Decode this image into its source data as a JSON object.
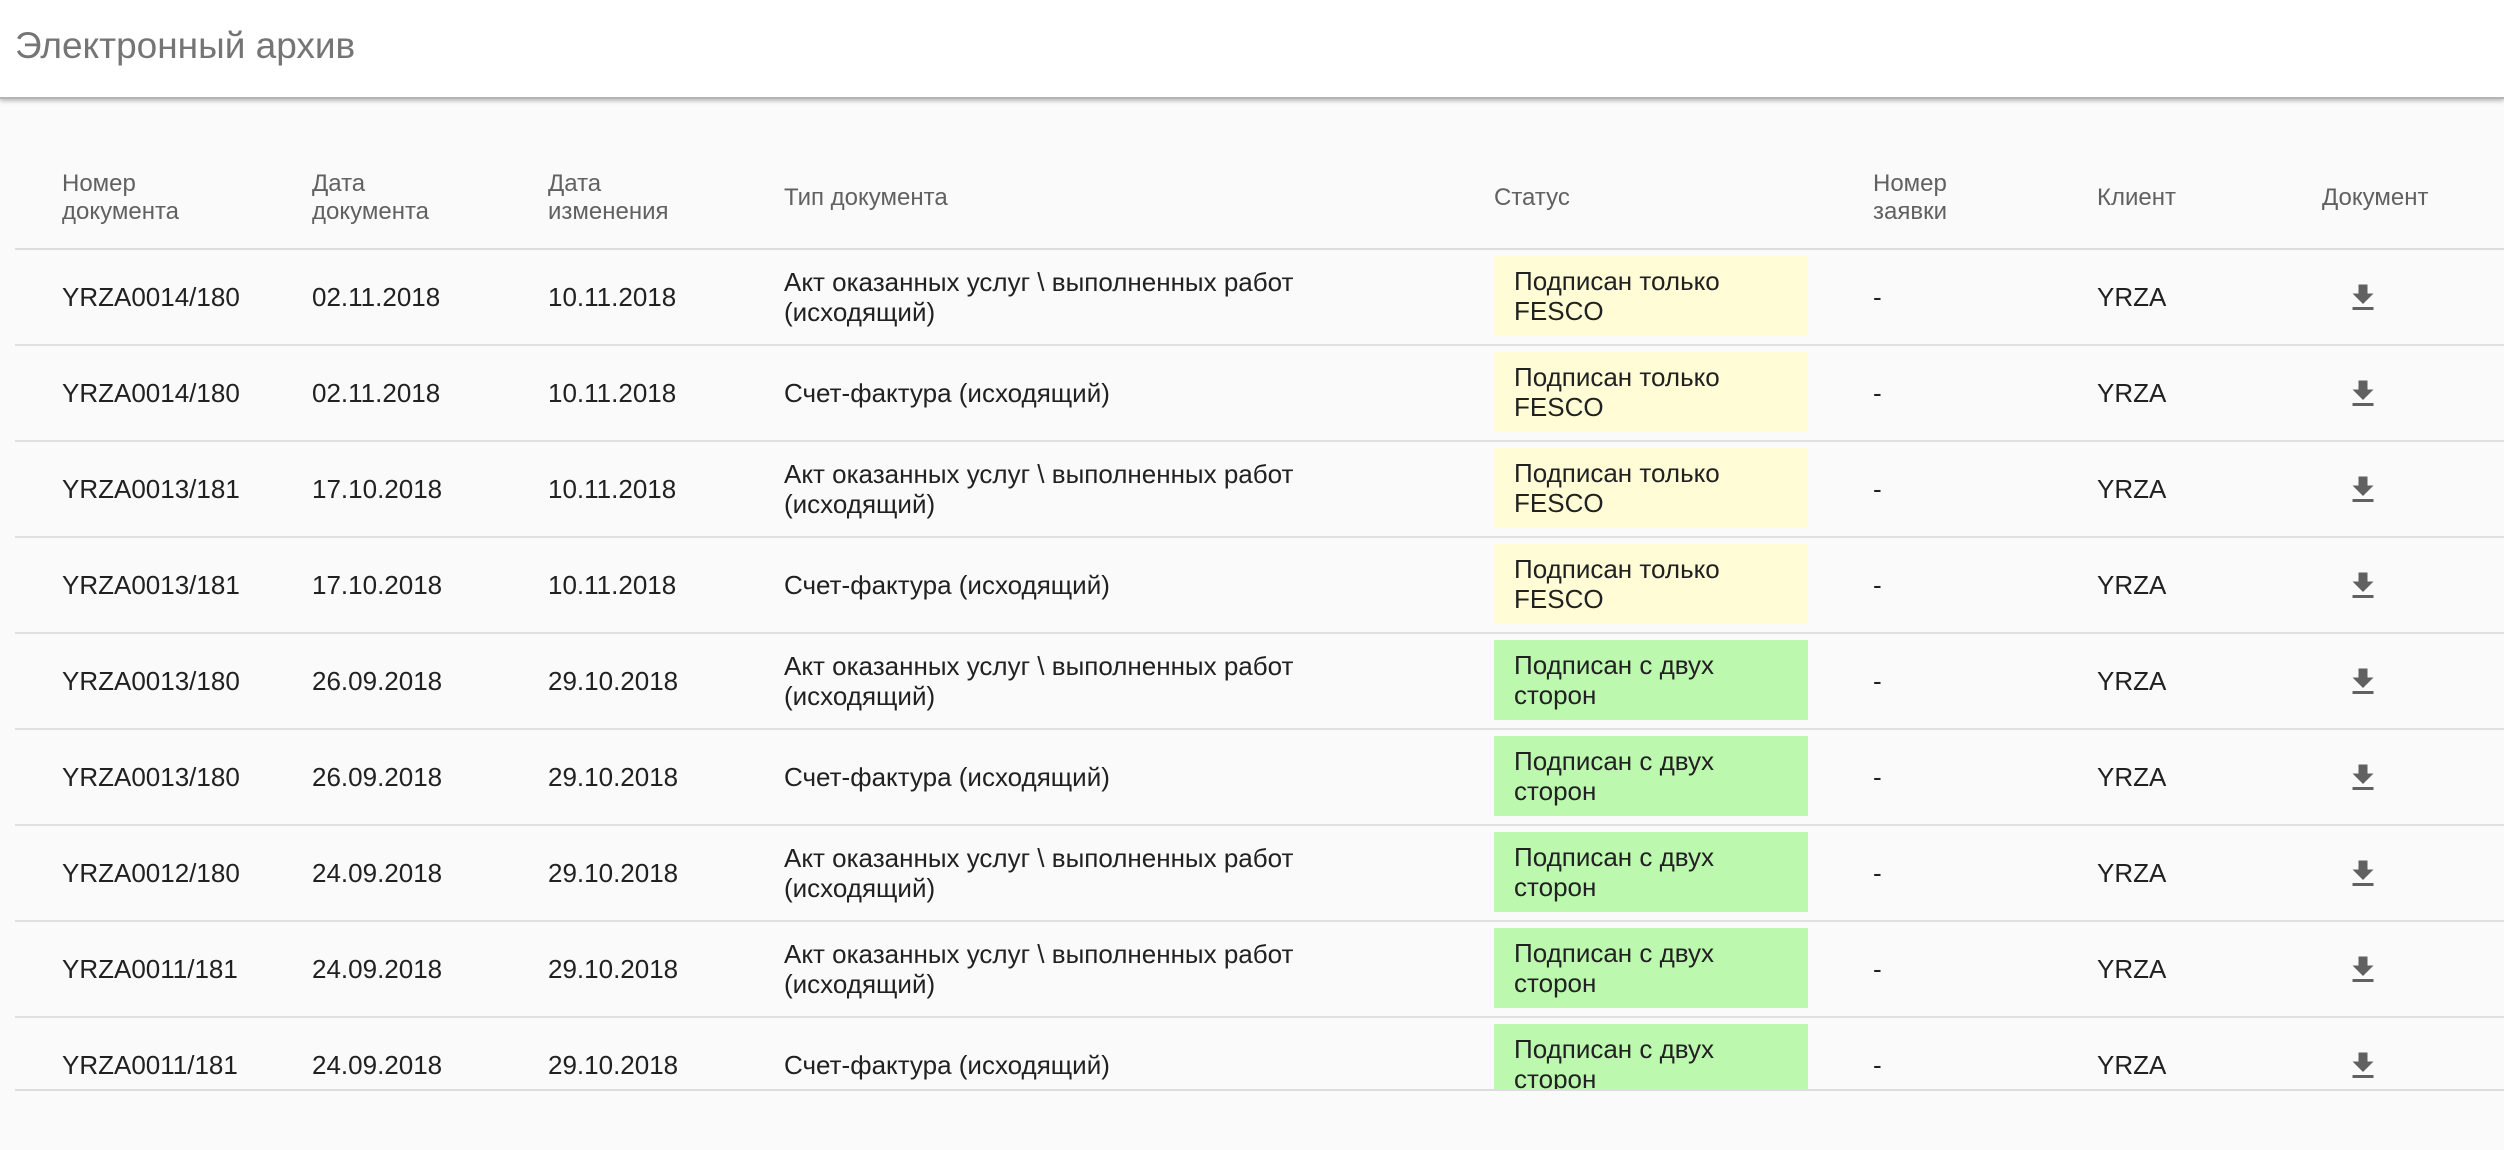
{
  "page": {
    "title": "Электронный архив"
  },
  "table": {
    "headers": {
      "doc_number": "Номер\nдокумента",
      "doc_date": "Дата\nдокумента",
      "modified_date": "Дата\nизменения",
      "doc_type": "Тип документа",
      "status": "Статус",
      "request_number": "Номер\nзаявки",
      "client": "Клиент",
      "document": "Документ"
    },
    "status_colors": {
      "fesco_only": "#fffcd6",
      "both_sides": "#bdf8af"
    },
    "download_icon": "download-icon",
    "rows": [
      {
        "doc_number": "YRZA0014/180",
        "doc_date": "02.11.2018",
        "modified_date": "10.11.2018",
        "doc_type": "Акт оказанных услуг \\ выполненных работ\n(исходящий)",
        "status": "Подписан только\nFESCO",
        "status_kind": "fesco_only",
        "request_number": "-",
        "client": "YRZA"
      },
      {
        "doc_number": "YRZA0014/180",
        "doc_date": "02.11.2018",
        "modified_date": "10.11.2018",
        "doc_type": "Счет-фактура (исходящий)",
        "status": "Подписан только\nFESCO",
        "status_kind": "fesco_only",
        "request_number": "-",
        "client": "YRZA"
      },
      {
        "doc_number": "YRZA0013/181",
        "doc_date": "17.10.2018",
        "modified_date": "10.11.2018",
        "doc_type": "Акт оказанных услуг \\ выполненных работ\n(исходящий)",
        "status": "Подписан только\nFESCO",
        "status_kind": "fesco_only",
        "request_number": "-",
        "client": "YRZA"
      },
      {
        "doc_number": "YRZA0013/181",
        "doc_date": "17.10.2018",
        "modified_date": "10.11.2018",
        "doc_type": "Счет-фактура (исходящий)",
        "status": "Подписан только\nFESCO",
        "status_kind": "fesco_only",
        "request_number": "-",
        "client": "YRZA"
      },
      {
        "doc_number": "YRZA0013/180",
        "doc_date": "26.09.2018",
        "modified_date": "29.10.2018",
        "doc_type": "Акт оказанных услуг \\ выполненных работ\n(исходящий)",
        "status": "Подписан с двух\nсторон",
        "status_kind": "both_sides",
        "request_number": "-",
        "client": "YRZA"
      },
      {
        "doc_number": "YRZA0013/180",
        "doc_date": "26.09.2018",
        "modified_date": "29.10.2018",
        "doc_type": "Счет-фактура (исходящий)",
        "status": "Подписан с двух\nсторон",
        "status_kind": "both_sides",
        "request_number": "-",
        "client": "YRZA"
      },
      {
        "doc_number": "YRZA0012/180",
        "doc_date": "24.09.2018",
        "modified_date": "29.10.2018",
        "doc_type": "Акт оказанных услуг \\ выполненных работ\n(исходящий)",
        "status": "Подписан с двух\nсторон",
        "status_kind": "both_sides",
        "request_number": "-",
        "client": "YRZA"
      },
      {
        "doc_number": "YRZA0011/181",
        "doc_date": "24.09.2018",
        "modified_date": "29.10.2018",
        "doc_type": "Акт оказанных услуг \\ выполненных работ\n(исходящий)",
        "status": "Подписан с двух\nсторон",
        "status_kind": "both_sides",
        "request_number": "-",
        "client": "YRZA"
      },
      {
        "doc_number": "YRZA0011/181",
        "doc_date": "24.09.2018",
        "modified_date": "29.10.2018",
        "doc_type": "Счет-фактура (исходящий)",
        "status": "Подписан с двух\nсторон",
        "status_kind": "both_sides",
        "request_number": "-",
        "client": "YRZA"
      }
    ]
  }
}
